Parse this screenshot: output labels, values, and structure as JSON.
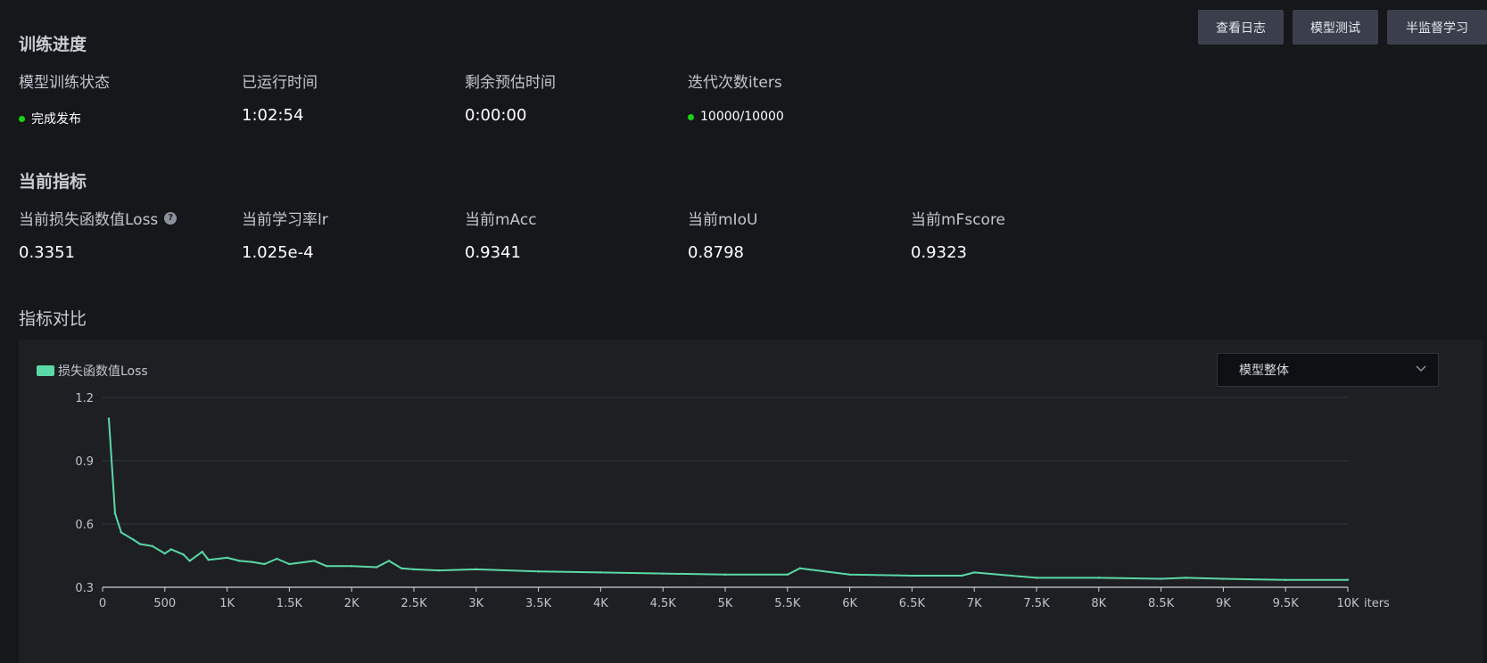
{
  "toolbar": {
    "view_log": "查看日志",
    "model_test": "模型测试",
    "semi_supervised": "半监督学习"
  },
  "progress": {
    "title": "训练进度",
    "status_label": "模型训练状态",
    "status_value": "完成发布",
    "status_color": "#1ad01a",
    "elapsed_label": "已运行时间",
    "elapsed_value": "1:02:54",
    "remaining_label": "剩余预估时间",
    "remaining_value": "0:00:00",
    "iters_label": "迭代次数iters",
    "iters_value": "10000/10000"
  },
  "metrics": {
    "title": "当前指标",
    "loss_label": "当前损失函数值Loss",
    "loss_value": "0.3351",
    "lr_label": "当前学习率lr",
    "lr_value": "1.025e-4",
    "macc_label": "当前mAcc",
    "macc_value": "0.9341",
    "miou_label": "当前mIoU",
    "miou_value": "0.8798",
    "mfscore_label": "当前mFscore",
    "mfscore_value": "0.9323"
  },
  "comparison": {
    "title": "指标对比",
    "select_value": "模型整体"
  },
  "chart_data": {
    "type": "line",
    "xlabel": "iters",
    "ylabel": "",
    "xlim": [
      0,
      10000
    ],
    "ylim": [
      0.3,
      1.2
    ],
    "grid": true,
    "legend_placement": "top-left",
    "x_ticks": [
      "0",
      "500",
      "1K",
      "1.5K",
      "2K",
      "2.5K",
      "3K",
      "3.5K",
      "4K",
      "4.5K",
      "5K",
      "5.5K",
      "6K",
      "6.5K",
      "7K",
      "7.5K",
      "8K",
      "8.5K",
      "9K",
      "9.5K",
      "10K"
    ],
    "y_ticks": [
      "0.3",
      "0.6",
      "0.9",
      "1.2"
    ],
    "series": [
      {
        "name": "损失函数值Loss",
        "color": "#5ad8a6",
        "x": [
          50,
          100,
          150,
          250,
          300,
          400,
          500,
          550,
          650,
          700,
          800,
          850,
          1000,
          1100,
          1200,
          1300,
          1400,
          1500,
          1700,
          1800,
          2000,
          2200,
          2300,
          2400,
          2500,
          2700,
          3000,
          3500,
          4000,
          4500,
          5000,
          5500,
          5600,
          6000,
          6500,
          6900,
          7000,
          7500,
          8000,
          8500,
          8700,
          9000,
          9500,
          10000
        ],
        "values": [
          1.1,
          0.65,
          0.56,
          0.525,
          0.505,
          0.495,
          0.46,
          0.48,
          0.455,
          0.425,
          0.468,
          0.43,
          0.44,
          0.425,
          0.42,
          0.41,
          0.435,
          0.41,
          0.425,
          0.4,
          0.4,
          0.395,
          0.425,
          0.39,
          0.385,
          0.38,
          0.385,
          0.375,
          0.37,
          0.365,
          0.36,
          0.36,
          0.39,
          0.36,
          0.355,
          0.355,
          0.37,
          0.345,
          0.345,
          0.34,
          0.345,
          0.34,
          0.335,
          0.335
        ]
      }
    ]
  }
}
